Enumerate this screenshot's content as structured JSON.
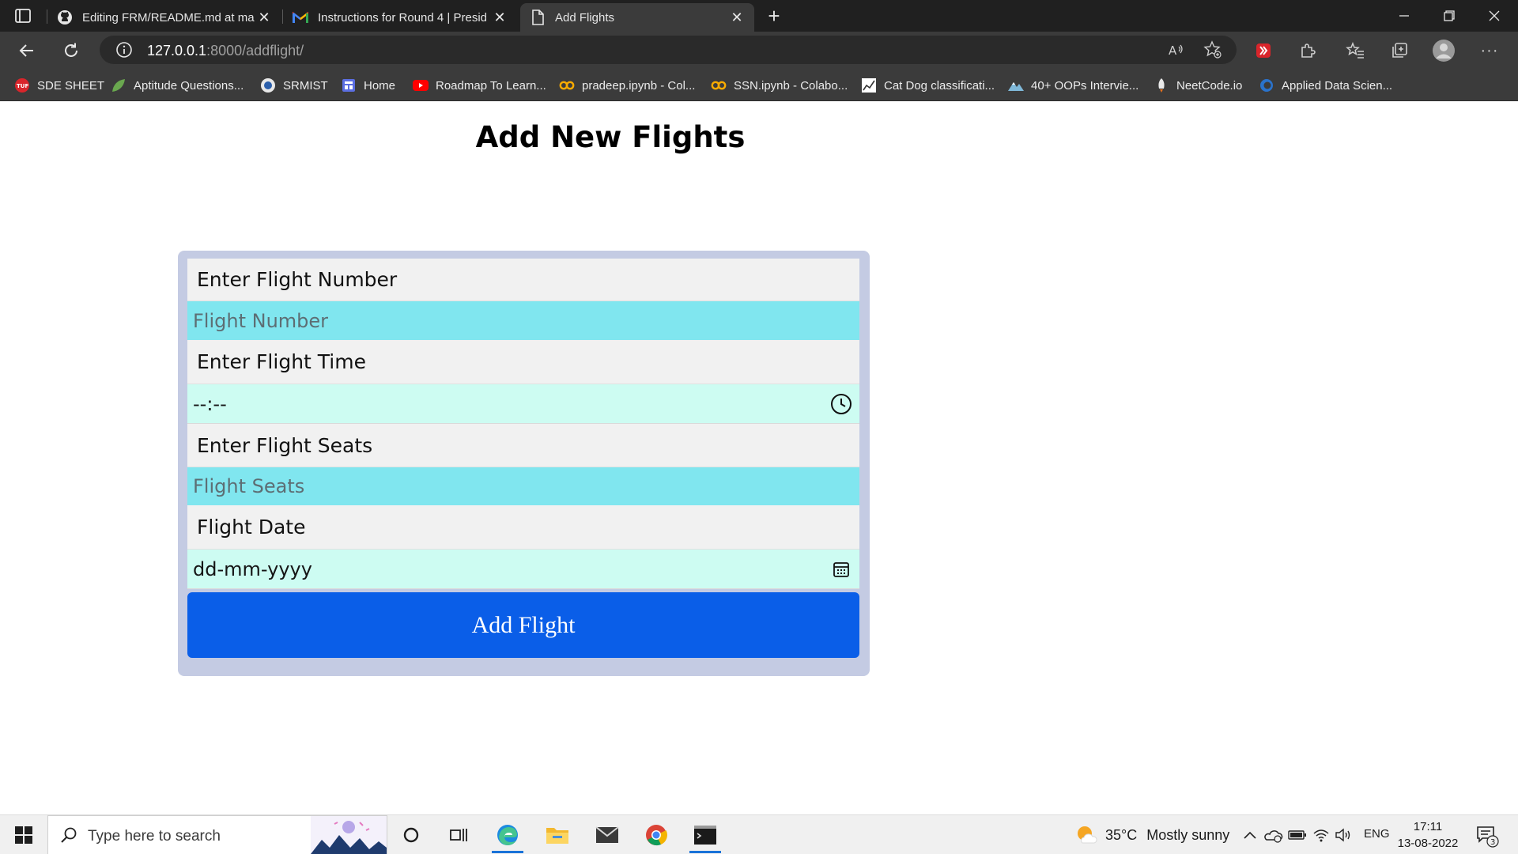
{
  "browser": {
    "tabs": [
      {
        "title": "Editing FRM/README.md at mai",
        "icon": "github-icon",
        "active": false
      },
      {
        "title": "Instructions for Round 4 | Presid",
        "icon": "gmail-icon",
        "active": false
      },
      {
        "title": "Add Flights",
        "icon": "page-icon",
        "active": true
      }
    ],
    "address": {
      "host": "127.0.0.1",
      "path": ":8000/addflight/"
    },
    "bookmarks": [
      {
        "label": "SDE SHEET",
        "icon": "tuf-icon"
      },
      {
        "label": "Aptitude Questions...",
        "icon": "leaf-icon"
      },
      {
        "label": "SRMIST",
        "icon": "srm-icon"
      },
      {
        "label": "Home",
        "icon": "home-grid-icon"
      },
      {
        "label": "Roadmap To Learn...",
        "icon": "youtube-icon"
      },
      {
        "label": "pradeep.ipynb - Col...",
        "icon": "colab-icon"
      },
      {
        "label": "SSN.ipynb - Colabo...",
        "icon": "colab-icon"
      },
      {
        "label": "Cat Dog classificati...",
        "icon": "chart-icon"
      },
      {
        "label": "40+ OOPs Intervie...",
        "icon": "mountain-icon"
      },
      {
        "label": "NeetCode.io",
        "icon": "rocket-icon"
      },
      {
        "label": "Applied Data Scien...",
        "icon": "coursera-icon"
      }
    ]
  },
  "page": {
    "title": "Add New Flights",
    "form": {
      "flight_number_label": "Enter Flight Number",
      "flight_number_placeholder": "Flight Number",
      "flight_time_label": "Enter Flight Time",
      "flight_time_value": "--:--",
      "flight_seats_label": "Enter Flight Seats",
      "flight_seats_placeholder": "Flight Seats",
      "flight_date_label": "Flight Date",
      "flight_date_value": "dd-mm-yyyy",
      "submit_label": "Add Flight"
    }
  },
  "taskbar": {
    "search_placeholder": "Type here to search",
    "weather": {
      "temp": "35°C",
      "text": "Mostly sunny"
    },
    "language": "ENG",
    "time": "17:11",
    "date": "13-08-2022",
    "notifications": "3"
  },
  "colors": {
    "primary_button": "#0a5ee8",
    "input_cyan": "#80e6ef",
    "input_mint": "#cdfcf2",
    "card_bg": "#c4cbe3"
  }
}
